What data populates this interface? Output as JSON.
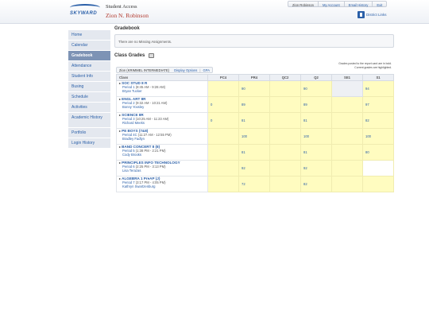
{
  "header": {
    "logo_text": "SKYWARD",
    "app_title": "Student Access",
    "user_name": "Zion N. Robinson",
    "menu": {
      "user": "Zion Robinson",
      "my_account": "My Account",
      "email_history": "Email History",
      "exit": "Exit"
    },
    "district_links": "District Links"
  },
  "sidebar": {
    "items": [
      {
        "label": "Home"
      },
      {
        "label": "Calendar"
      },
      {
        "label": "Gradebook"
      },
      {
        "label": "Attendance"
      },
      {
        "label": "Student Info"
      },
      {
        "label": "Busing"
      },
      {
        "label": "Schedule"
      },
      {
        "label": "Activities"
      },
      {
        "label": "Academic History"
      },
      {
        "label": "Portfolio"
      },
      {
        "label": "Login History"
      }
    ],
    "active_index": 2
  },
  "main": {
    "page_title": "Gradebook",
    "alert": "There are no Missing Assignments.",
    "section_title": "Class Grades",
    "legend_line1": "Grades posted to the report card are in bold.",
    "legend_line2": "Current grades are highlighted.",
    "student_bar": {
      "student": "Zion (KRIMMEL INTERMEDIATE)",
      "display_options": "Display Options",
      "separator": "|",
      "gpa": "GPA"
    },
    "columns": [
      "Class",
      "PC4",
      "PR4",
      "QC2",
      "Q2",
      "SE1",
      "S1"
    ],
    "rows": [
      {
        "course": "SOC STUD 8 R",
        "period": "Period 1",
        "time": "(8:45 AM - 9:28 AM)",
        "teacher": "Bryan Tucker",
        "grades": [
          "",
          "90",
          "",
          "90",
          "",
          "94"
        ]
      },
      {
        "course": "ENGL ART 8R",
        "period": "Period 2",
        "time": "(9:32 AM - 10:21 AM)",
        "teacher": "Bonny Yoxsley",
        "grades": [
          "0",
          "89",
          "",
          "89",
          "",
          "97"
        ]
      },
      {
        "course": "SCIENCE 8R",
        "period": "Period 3",
        "time": "(10:25 AM - 11:23 AM)",
        "teacher": "Richard Meeks",
        "grades": [
          "0",
          "81",
          "",
          "81",
          "",
          "82"
        ]
      },
      {
        "course": "PE BOYS (7&8)",
        "period": "Period 4C",
        "time": "(11:27 AM - 12:55 PM)",
        "teacher": "Bradley Fadlyn",
        "grades": [
          "",
          "100",
          "",
          "100",
          "",
          "100"
        ]
      },
      {
        "course": "BAND CONCERT 8 (8)",
        "period": "Period 5",
        "time": "(1:38 PM - 2:21 PM)",
        "teacher": "Cody Brooks",
        "grades": [
          "",
          "81",
          "",
          "81",
          "",
          "80"
        ]
      },
      {
        "course": "PRINCIPLES INFO TECHNOLOGY",
        "period": "Period 6",
        "time": "(2:25 PM - 3:13 PM)",
        "teacher": "Lisa Terazas",
        "grades": [
          "",
          "92",
          "",
          "92",
          "",
          ""
        ]
      },
      {
        "course": "ALGEBRA 1 PreAP (J)",
        "period": "Period 7",
        "time": "(3:17 PM - 4:05 PM)",
        "teacher": "Kathryn Swartzenburg",
        "grades": [
          "",
          "72",
          "",
          "82",
          "",
          ""
        ]
      }
    ]
  },
  "colors": {
    "brand": "#2a5fa8",
    "highlight": "#fffcc0",
    "active_nav": "#7d93b5"
  }
}
